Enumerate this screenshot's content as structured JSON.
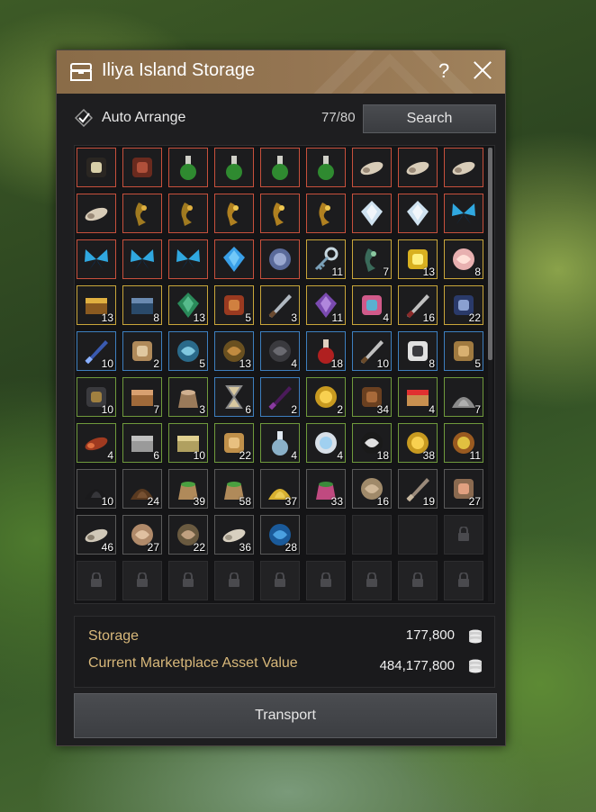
{
  "window": {
    "title": "Iliya Island Storage",
    "help_label": "?",
    "title_bar_color": "#947552"
  },
  "toolbar": {
    "auto_arrange_label": "Auto Arrange",
    "auto_arrange_checked": true,
    "slot_count": "77/80",
    "search_label": "Search"
  },
  "grade_colors": {
    "orange": "#c8503c",
    "yellow": "#c9a63a",
    "blue": "#3d7fbf",
    "green": "#6f9a3c",
    "white": "#5a5a5a"
  },
  "items": [
    {
      "icon": "ore-icon",
      "grade": "orange",
      "qty": ""
    },
    {
      "icon": "timber-icon",
      "grade": "orange",
      "qty": ""
    },
    {
      "icon": "green-potion-icon",
      "grade": "orange",
      "qty": ""
    },
    {
      "icon": "green-potion-icon",
      "grade": "orange",
      "qty": ""
    },
    {
      "icon": "green-potion-icon",
      "grade": "orange",
      "qty": ""
    },
    {
      "icon": "green-potion-icon",
      "grade": "orange",
      "qty": ""
    },
    {
      "icon": "larva-icon",
      "grade": "orange",
      "qty": ""
    },
    {
      "icon": "larva-icon",
      "grade": "orange",
      "qty": ""
    },
    {
      "icon": "larva-icon",
      "grade": "orange",
      "qty": ""
    },
    {
      "icon": "larva-icon",
      "grade": "orange",
      "qty": ""
    },
    {
      "icon": "gold-dragon-icon",
      "grade": "orange",
      "qty": ""
    },
    {
      "icon": "gold-dragon-icon",
      "grade": "orange",
      "qty": ""
    },
    {
      "icon": "gold-statue-icon",
      "grade": "orange",
      "qty": ""
    },
    {
      "icon": "gold-statue-icon",
      "grade": "orange",
      "qty": ""
    },
    {
      "icon": "gold-statue-icon",
      "grade": "orange",
      "qty": ""
    },
    {
      "icon": "shining-crystal-icon",
      "grade": "orange",
      "qty": ""
    },
    {
      "icon": "shining-crystal-icon",
      "grade": "orange",
      "qty": ""
    },
    {
      "icon": "blue-butterfly-icon",
      "grade": "orange",
      "qty": ""
    },
    {
      "icon": "blue-butterfly-icon",
      "grade": "orange",
      "qty": ""
    },
    {
      "icon": "blue-butterfly-icon",
      "grade": "orange",
      "qty": ""
    },
    {
      "icon": "blue-butterfly-icon",
      "grade": "orange",
      "qty": ""
    },
    {
      "icon": "blue-gem-icon",
      "grade": "orange",
      "qty": ""
    },
    {
      "icon": "coral-plate-icon",
      "grade": "orange",
      "qty": ""
    },
    {
      "icon": "key-icon",
      "grade": "yellow",
      "qty": "11"
    },
    {
      "icon": "serpent-icon",
      "grade": "yellow",
      "qty": "7"
    },
    {
      "icon": "gold-nugget-icon",
      "grade": "yellow",
      "qty": "13"
    },
    {
      "icon": "seashell-icon",
      "grade": "yellow",
      "qty": "8"
    },
    {
      "icon": "treasure-chest-icon",
      "grade": "yellow",
      "qty": "13"
    },
    {
      "icon": "book-icon",
      "grade": "yellow",
      "qty": "8"
    },
    {
      "icon": "green-stone-icon",
      "grade": "yellow",
      "qty": "13"
    },
    {
      "icon": "red-wing-icon",
      "grade": "yellow",
      "qty": "5"
    },
    {
      "icon": "dagger-icon",
      "grade": "yellow",
      "qty": "3"
    },
    {
      "icon": "purple-crystal-icon",
      "grade": "yellow",
      "qty": "11"
    },
    {
      "icon": "rainbow-scroll-icon",
      "grade": "yellow",
      "qty": "4"
    },
    {
      "icon": "knife-icon",
      "grade": "yellow",
      "qty": "16"
    },
    {
      "icon": "armor-piece-icon",
      "grade": "yellow",
      "qty": "22"
    },
    {
      "icon": "blue-feather-icon",
      "grade": "blue",
      "qty": "10"
    },
    {
      "icon": "paper-bundle-icon",
      "grade": "blue",
      "qty": "2"
    },
    {
      "icon": "spider-web-icon",
      "grade": "blue",
      "qty": "5"
    },
    {
      "icon": "nest-icon",
      "grade": "blue",
      "qty": "13"
    },
    {
      "icon": "leather-coat-icon",
      "grade": "blue",
      "qty": "4"
    },
    {
      "icon": "red-vial-icon",
      "grade": "blue",
      "qty": "18"
    },
    {
      "icon": "axe-head-icon",
      "grade": "blue",
      "qty": "10"
    },
    {
      "icon": "tea-cup-icon",
      "grade": "blue",
      "qty": "8"
    },
    {
      "icon": "ore-chunk-icon",
      "grade": "blue",
      "qty": "5"
    },
    {
      "icon": "binoculars-icon",
      "grade": "green",
      "qty": "10"
    },
    {
      "icon": "wooden-crate-icon",
      "grade": "green",
      "qty": "7"
    },
    {
      "icon": "sack-icon",
      "grade": "green",
      "qty": "3"
    },
    {
      "icon": "hourglass-icon",
      "grade": "blue",
      "qty": "6"
    },
    {
      "icon": "purple-quill-icon",
      "grade": "blue",
      "qty": "2"
    },
    {
      "icon": "gold-coin-icon",
      "grade": "green",
      "qty": "2"
    },
    {
      "icon": "wood-plank-icon",
      "grade": "green",
      "qty": "34"
    },
    {
      "icon": "first-aid-box-icon",
      "grade": "green",
      "qty": "4"
    },
    {
      "icon": "stone-pile-icon",
      "grade": "green",
      "qty": "7"
    },
    {
      "icon": "sea-cucumber-icon",
      "grade": "green",
      "qty": "4"
    },
    {
      "icon": "stone-slab-icon",
      "grade": "green",
      "qty": "6"
    },
    {
      "icon": "bread-tray-icon",
      "grade": "green",
      "qty": "10"
    },
    {
      "icon": "bread-loaf-icon",
      "grade": "green",
      "qty": "22"
    },
    {
      "icon": "water-flask-icon",
      "grade": "green",
      "qty": "4"
    },
    {
      "icon": "pearl-icon",
      "grade": "green",
      "qty": "4"
    },
    {
      "icon": "pirate-flag-icon",
      "grade": "green",
      "qty": "18"
    },
    {
      "icon": "gold-coin-icon",
      "grade": "green",
      "qty": "38"
    },
    {
      "icon": "food-plate-icon",
      "grade": "green",
      "qty": "11"
    },
    {
      "icon": "charcoal-icon",
      "grade": "white",
      "qty": "10"
    },
    {
      "icon": "soil-pile-icon",
      "grade": "white",
      "qty": "24"
    },
    {
      "icon": "seed-bag-icon",
      "grade": "white",
      "qty": "39"
    },
    {
      "icon": "seed-bag-icon",
      "grade": "white",
      "qty": "58"
    },
    {
      "icon": "sand-pile-icon",
      "grade": "white",
      "qty": "37"
    },
    {
      "icon": "pink-sack-icon",
      "grade": "white",
      "qty": "33"
    },
    {
      "icon": "rock-icon",
      "grade": "white",
      "qty": "16"
    },
    {
      "icon": "axe-blade-icon",
      "grade": "white",
      "qty": "19"
    },
    {
      "icon": "shrimp-basket-icon",
      "grade": "white",
      "qty": "27"
    },
    {
      "icon": "bone-fragment-icon",
      "grade": "white",
      "qty": "46"
    },
    {
      "icon": "hide-icon",
      "grade": "white",
      "qty": "27"
    },
    {
      "icon": "clam-icon",
      "grade": "white",
      "qty": "22"
    },
    {
      "icon": "fish-bone-icon",
      "grade": "white",
      "qty": "36"
    },
    {
      "icon": "blue-rose-icon",
      "grade": "white",
      "qty": "28"
    }
  ],
  "empty_slots": 3,
  "locked_slots": 10,
  "storage": {
    "storage_label": "Storage",
    "storage_value": "177,800",
    "asset_label": "Current Marketplace Asset Value",
    "asset_value": "484,177,800"
  },
  "transport_label": "Transport"
}
